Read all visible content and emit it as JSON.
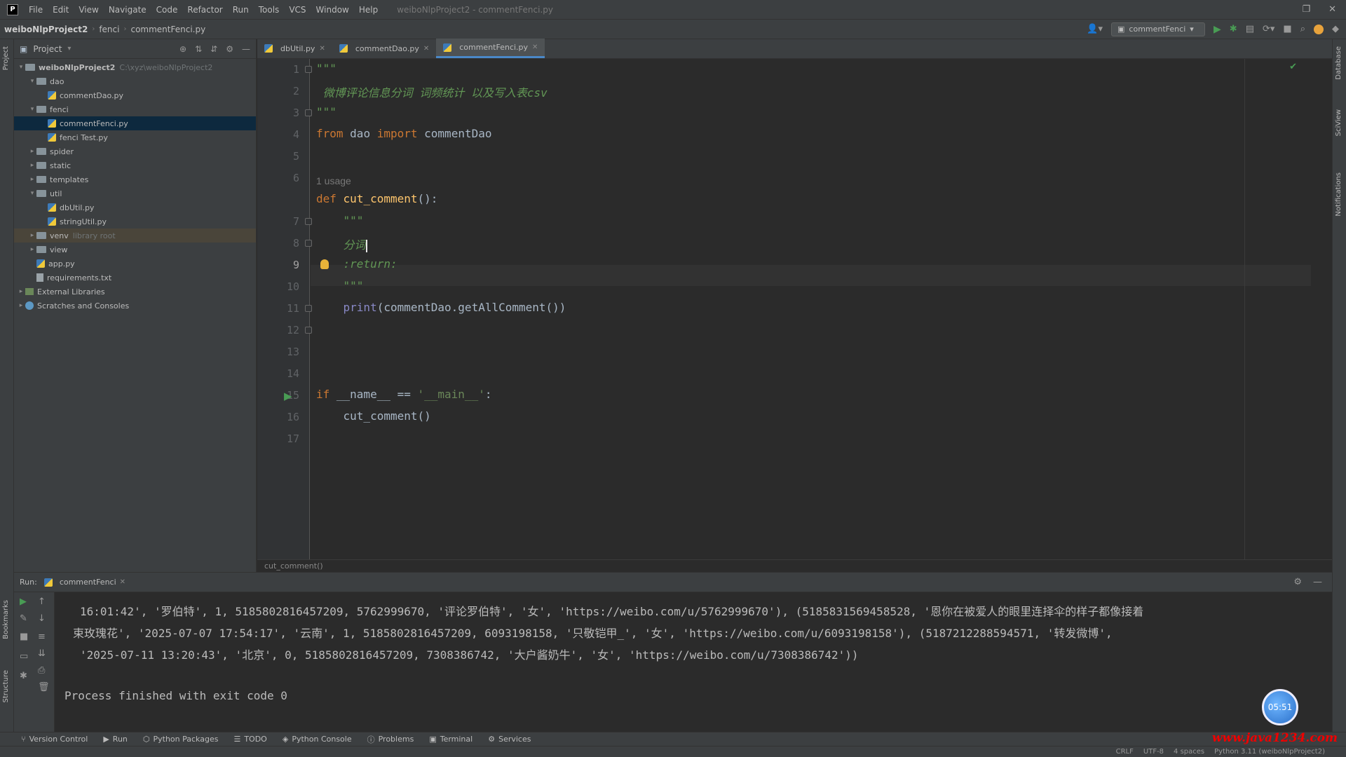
{
  "menu": [
    "File",
    "Edit",
    "View",
    "Navigate",
    "Code",
    "Refactor",
    "Run",
    "Tools",
    "VCS",
    "Window",
    "Help"
  ],
  "window_title": "weiboNlpProject2 - commentFenci.py",
  "breadcrumbs": [
    "weiboNlpProject2",
    "fenci",
    "commentFenci.py"
  ],
  "run_config": "commentFenci",
  "project_panel": {
    "title": "Project",
    "root": "weiboNlpProject2",
    "root_path": "C:\\xyz\\weiboNlpProject2",
    "items": [
      {
        "label": "dao",
        "type": "folder",
        "indent": 1,
        "open": true
      },
      {
        "label": "commentDao.py",
        "type": "py",
        "indent": 2
      },
      {
        "label": "fenci",
        "type": "folder",
        "indent": 1,
        "open": true
      },
      {
        "label": "commentFenci.py",
        "type": "py",
        "indent": 2
      },
      {
        "label": "fenci Test.py",
        "type": "py",
        "indent": 2
      },
      {
        "label": "spider",
        "type": "folder",
        "indent": 1
      },
      {
        "label": "static",
        "type": "folder",
        "indent": 1
      },
      {
        "label": "templates",
        "type": "folder",
        "indent": 1
      },
      {
        "label": "util",
        "type": "folder",
        "indent": 1,
        "open": true
      },
      {
        "label": "dbUtil.py",
        "type": "py",
        "indent": 2
      },
      {
        "label": "stringUtil.py",
        "type": "py",
        "indent": 2
      },
      {
        "label": "venv",
        "type": "folder",
        "indent": 1
      },
      {
        "label": "view",
        "type": "folder",
        "indent": 1
      },
      {
        "label": "app.py",
        "type": "py",
        "indent": 1
      },
      {
        "label": "requirements.txt",
        "type": "txt",
        "indent": 1
      },
      {
        "label": "External Libraries",
        "type": "lib",
        "indent": 0
      },
      {
        "label": "Scratches and Consoles",
        "type": "scratch",
        "indent": 0
      }
    ],
    "venv_hint": "library root"
  },
  "tabs": [
    "dbUtil.py",
    "commentDao.py",
    "commentFenci.py"
  ],
  "editor": {
    "line_numbers": [
      "1",
      "2",
      "3",
      "4",
      "5",
      "6",
      "7",
      "8",
      "9",
      "10",
      "11",
      "12",
      "13",
      "14",
      "15",
      "16",
      "17"
    ],
    "docstring_open": "\"\"\"",
    "doc_comment": "微博评论信息分词 词频统计 以及写入表csv",
    "docstring_close": "\"\"\"",
    "import_from": "from",
    "import_module": "dao",
    "import_kw": "import",
    "import_name": "commentDao",
    "usage_hint": "1 usage",
    "def_kw": "def",
    "func_name": "cut_comment",
    "func_sig": "():",
    "inner_doc_open": "\"\"\"",
    "inner_doc_text": "分词",
    "inner_doc_return": ":return:",
    "inner_doc_close": "\"\"\"",
    "print_fn": "print",
    "print_args": "(commentDao.getAllComment())",
    "if_kw": "if",
    "if_cond": " __name__ == ",
    "if_str": "'__main__'",
    "if_colon": ":",
    "main_call": "cut_comment()",
    "footer_crumb": "cut_comment()"
  },
  "run_panel": {
    "label": "Run:",
    "tab": "commentFenci",
    "console_lines": [
      "16:01:42', '罗伯特', 1, 5185802816457209, 5762999670, '评论罗伯特', '女', 'https://weibo.com/u/5762999670'), (5185831569458528, '恩你在被爱人的眼里连择伞的样子都像接着",
      "束玫瑰花', '2025-07-07 17:54:17', '云南', 1, 5185802816457209, 6093198158, '只敬铠甲_', '女', 'https://weibo.com/u/6093198158'), (5187212288594571, '转发微博',",
      "'2025-07-11 13:20:43', '北京', 0, 5185802816457209, 7308386742, '大户酱奶牛', '女', 'https://weibo.com/u/7308386742'))"
    ],
    "exit_line": "Process finished with exit code 0"
  },
  "bottom_tabs": [
    "Version Control",
    "Run",
    "Python Packages",
    "TODO",
    "Python Console",
    "Problems",
    "Terminal",
    "Services"
  ],
  "status": [
    "CRLF",
    "UTF-8",
    "4 spaces",
    "Python 3.11 (weiboNlpProject2)"
  ],
  "watermark": "www.java1234.com",
  "avatar_text": "05:51"
}
